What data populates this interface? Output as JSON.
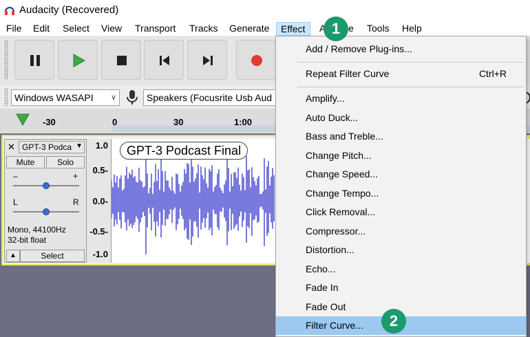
{
  "window": {
    "title": "Audacity (Recovered)"
  },
  "menubar": {
    "items": [
      "File",
      "Edit",
      "Select",
      "View",
      "Transport",
      "Tracks",
      "Generate",
      "Effect",
      "Analyze",
      "Tools",
      "Help"
    ]
  },
  "toolbar": {
    "buttons": [
      "pause-button",
      "play-button",
      "stop-button",
      "skip-start-button",
      "skip-end-button",
      "record-button"
    ]
  },
  "devicebar": {
    "host": "Windows WASAPI",
    "output_device": "Speakers (Focusrite Usb Aud"
  },
  "ruler": {
    "labels": [
      "-30",
      "0",
      "30",
      "1:00"
    ]
  },
  "track": {
    "name": "GPT-3 Podca",
    "mute_label": "Mute",
    "solo_label": "Solo",
    "gain_minus": "–",
    "gain_plus": "+",
    "pan_left": "L",
    "pan_right": "R",
    "info_line1": "Mono, 44100Hz",
    "info_line2": "32-bit float",
    "select_label": "Select",
    "close_glyph": "✕",
    "collapse_glyph": "▲",
    "clip_name": "GPT-3 Podcast Final",
    "scale": [
      "1.0",
      "0.5-",
      "0.0-",
      "-0.5-",
      "-1.0"
    ],
    "waveform_color": "#3f3fcf"
  },
  "effect_menu": {
    "top_items": [
      {
        "label": "Add / Remove Plug-ins..."
      }
    ],
    "mid_items": [
      {
        "label": "Repeat Filter Curve",
        "shortcut": "Ctrl+R"
      }
    ],
    "effects": [
      "Amplify...",
      "Auto Duck...",
      "Bass and Treble...",
      "Change Pitch...",
      "Change Speed...",
      "Change Tempo...",
      "Click Removal...",
      "Compressor...",
      "Distortion...",
      "Echo...",
      "Fade In",
      "Fade Out",
      "Filter Curve..."
    ],
    "highlighted": "Filter Curve...",
    "highlight_color": "#9bc9f0"
  },
  "callouts": {
    "one": "1",
    "two": "2",
    "color": "#1d9a6c"
  }
}
